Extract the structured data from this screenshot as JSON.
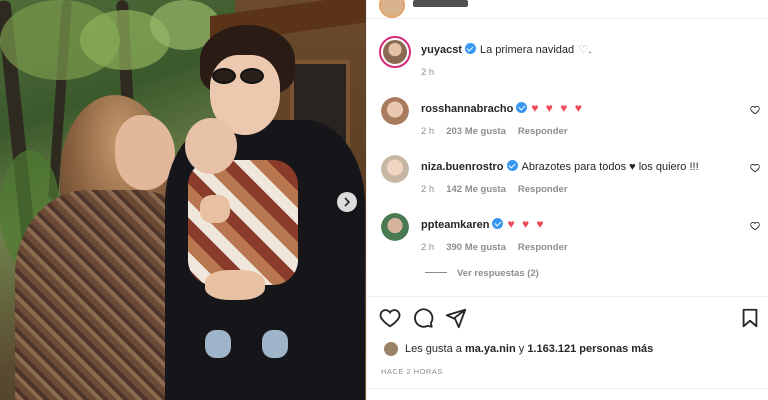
{
  "post": {
    "author": "yuyacst",
    "caption": "La primera navidad",
    "caption_heart": "♡",
    "caption_end": ".",
    "time_ago": "2 h"
  },
  "comments": [
    {
      "user": "rosshannabracho",
      "text": "♥ ♥ ♥ ♥",
      "time": "2 h",
      "likes": "203 Me gusta",
      "reply": "Responder"
    },
    {
      "user": "niza.buenrostro",
      "text": "Abrazotes para todos ♥ los quiero !!!",
      "time": "2 h",
      "likes": "142 Me gusta",
      "reply": "Responder"
    },
    {
      "user": "ppteamkaren",
      "text": "♥ ♥ ♥",
      "time": "2 h",
      "likes": "390 Me gusta",
      "reply": "Responder"
    }
  ],
  "view_replies": "Ver respuestas (2)",
  "likes_summary": {
    "prefix": "Les gusta a",
    "user": "ma.ya.nin",
    "middle": "y",
    "count": "1.163.121 personas más"
  },
  "posted_when": "HACE 2 HORAS",
  "icons": [
    "heart-icon",
    "comment-icon",
    "share-icon",
    "bookmark-icon",
    "verified-icon",
    "chevron-right-icon"
  ],
  "colors": {
    "verified": "#3897f0",
    "heart": "#ed4956",
    "muted": "#8e8e8e",
    "text": "#262626"
  }
}
